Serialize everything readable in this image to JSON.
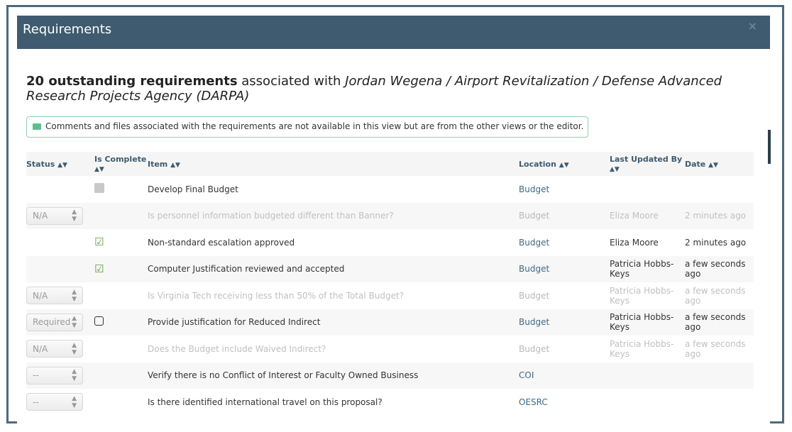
{
  "modal": {
    "title": "Requirements",
    "close": "×"
  },
  "summary": {
    "bold": "20 outstanding requirements",
    "mid": " associated with ",
    "italic": "Jordan Wegena / Airport Revitalization / Defense Advanced Research Projects Agency (DARPA)"
  },
  "notice": "Comments and files associated with the requirements are not available in this view but are from the other views or the editor.",
  "columns": {
    "status": "Status",
    "complete": "Is Complete",
    "item": "Item",
    "location": "Location",
    "updated": "Last Updated By",
    "date": "Date"
  },
  "rows": [
    {
      "status": "",
      "complete": "gray",
      "item": "Develop Final Budget",
      "location": "Budget",
      "by": "",
      "date": "",
      "muted": false
    },
    {
      "status": "N/A",
      "complete": "",
      "item": "Is personnel information budgeted different than Banner?",
      "location": "Budget",
      "by": "Eliza Moore",
      "date": "2 minutes ago",
      "muted": true
    },
    {
      "status": "",
      "complete": "checked",
      "item": "Non-standard escalation approved",
      "location": "Budget",
      "by": "Eliza Moore",
      "date": "2 minutes ago",
      "muted": false
    },
    {
      "status": "",
      "complete": "checked",
      "item": "Computer Justification reviewed and accepted",
      "location": "Budget",
      "by": "Patricia Hobbs-Keys",
      "date": "a few seconds ago",
      "muted": false
    },
    {
      "status": "N/A",
      "complete": "",
      "item": "Is Virginia Tech receiving less than 50% of the Total Budget?",
      "location": "Budget",
      "by": "Patricia Hobbs-Keys",
      "date": "a few seconds ago",
      "muted": true
    },
    {
      "status": "Required",
      "complete": "unchecked",
      "item": "Provide justification for Reduced Indirect",
      "location": "Budget",
      "by": "Patricia Hobbs-Keys",
      "date": "a few seconds ago",
      "muted": false
    },
    {
      "status": "N/A",
      "complete": "",
      "item": "Does the Budget include Waived Indirect?",
      "location": "Budget",
      "by": "Patricia Hobbs-Keys",
      "date": "a few seconds ago",
      "muted": true
    },
    {
      "status": "--",
      "complete": "",
      "item": "Verify there is no Conflict of Interest or Faculty Owned Business",
      "location": "COI",
      "by": "",
      "date": "",
      "muted": false
    },
    {
      "status": "--",
      "complete": "",
      "item": "Is there identified international travel on this proposal?",
      "location": "OESRC",
      "by": "",
      "date": "",
      "muted": false
    }
  ]
}
